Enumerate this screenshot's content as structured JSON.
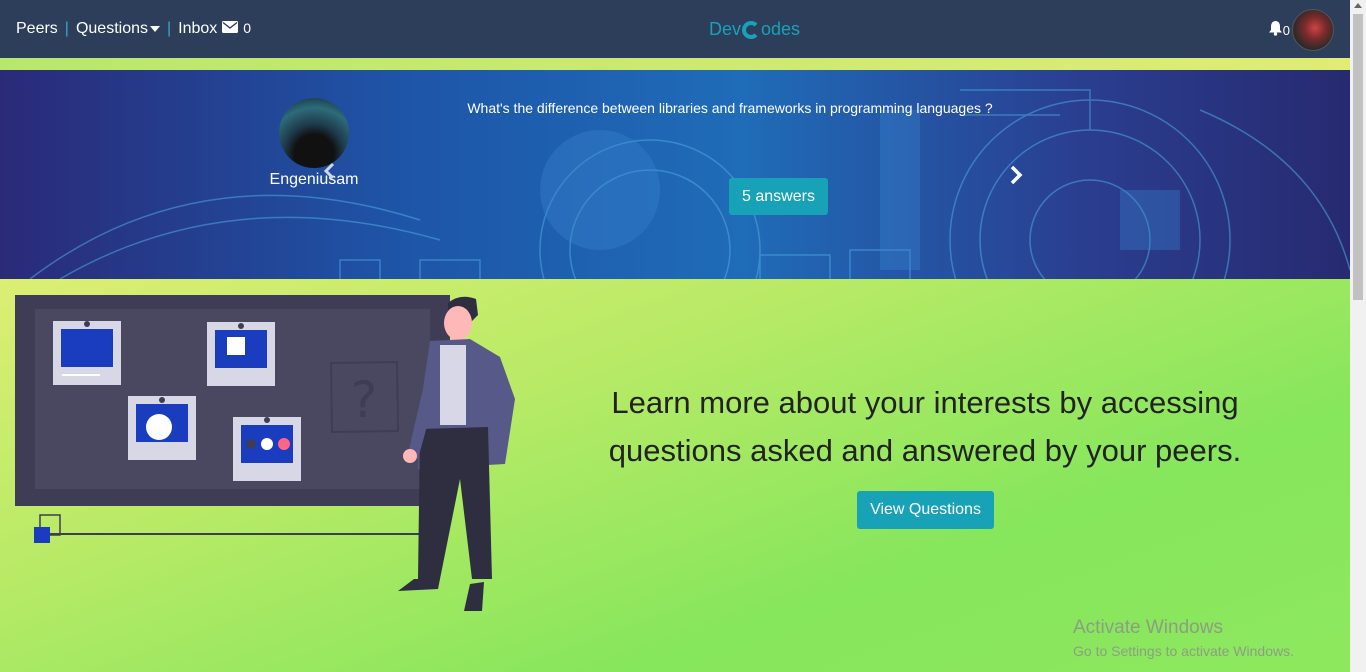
{
  "navbar": {
    "peers": "Peers",
    "separator": "|",
    "questions": "Questions",
    "inbox": "Inbox",
    "inbox_count": "0",
    "brand_left": "Dev",
    "brand_right": "odes",
    "notifications_count": "0"
  },
  "carousel": {
    "asker_name": "Engeniusam",
    "question": "What's the difference between libraries and frameworks in programming languages ?",
    "answers_label": "5 answers"
  },
  "main": {
    "tagline": "Learn more about your interests by accessing questions asked and answered by your peers.",
    "view_button": "View Questions"
  },
  "watermark": {
    "line1": "Activate Windows",
    "line2": "Go to Settings to activate Windows."
  },
  "colors": {
    "navbar_bg": "#2c3e5a",
    "accent": "#17a2b8",
    "hero_blue": "#1f6cb8",
    "green": "#8fe85a"
  },
  "icons": [
    "envelope-icon",
    "caret-down-icon",
    "bell-icon",
    "chevron-right-icon",
    "chevron-left-icon"
  ]
}
